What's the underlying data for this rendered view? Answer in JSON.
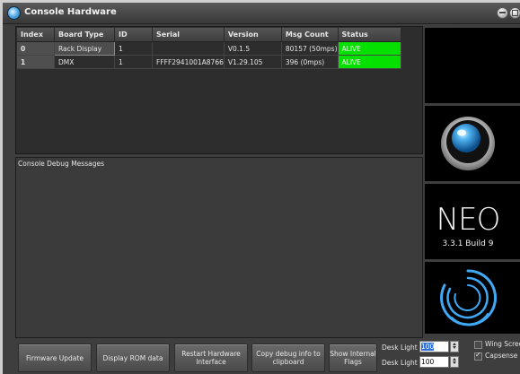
{
  "window": {
    "title": "Console Hardware",
    "controls": [
      "minimize-icon",
      "maximize-icon"
    ]
  },
  "board_table": {
    "columns": [
      "Index",
      "Board Type",
      "ID",
      "Serial",
      "Version",
      "Msg Count",
      "Status"
    ],
    "rows": [
      [
        "0",
        "Rack Display",
        "1",
        "",
        "V0.1.5",
        "80157 (50mps)",
        "ALIVE"
      ],
      [
        "1",
        "DMX",
        "1",
        "FFFF2941001A8766",
        "V1.29.105",
        "396 (0mps)",
        "ALIVE"
      ]
    ],
    "status_color": "#06e000"
  },
  "debug": {
    "label": "Console Debug Messages"
  },
  "branding": {
    "logo": "NEO",
    "build": "3.3.1 Build 9"
  },
  "buttons": {
    "firmware_update": "Firmware Update",
    "display_rom": "Display ROM data",
    "restart_hw_1": "Restart Hardware",
    "restart_hw_2": "Interface",
    "copy_debug_1": "Copy debug info to",
    "copy_debug_2": "clipboard",
    "show_flags_1": "Show Internal",
    "show_flags_2": "Flags"
  },
  "desk_lights": {
    "light1_label": "Desk Light 1",
    "light1_value": "100",
    "light2_label": "Desk Light 2",
    "light2_value": "100"
  },
  "options": {
    "wing_screen_label": "Wing Screen",
    "wing_screen_checked": false,
    "capsense_label": "Capsense",
    "capsense_checked": true
  }
}
